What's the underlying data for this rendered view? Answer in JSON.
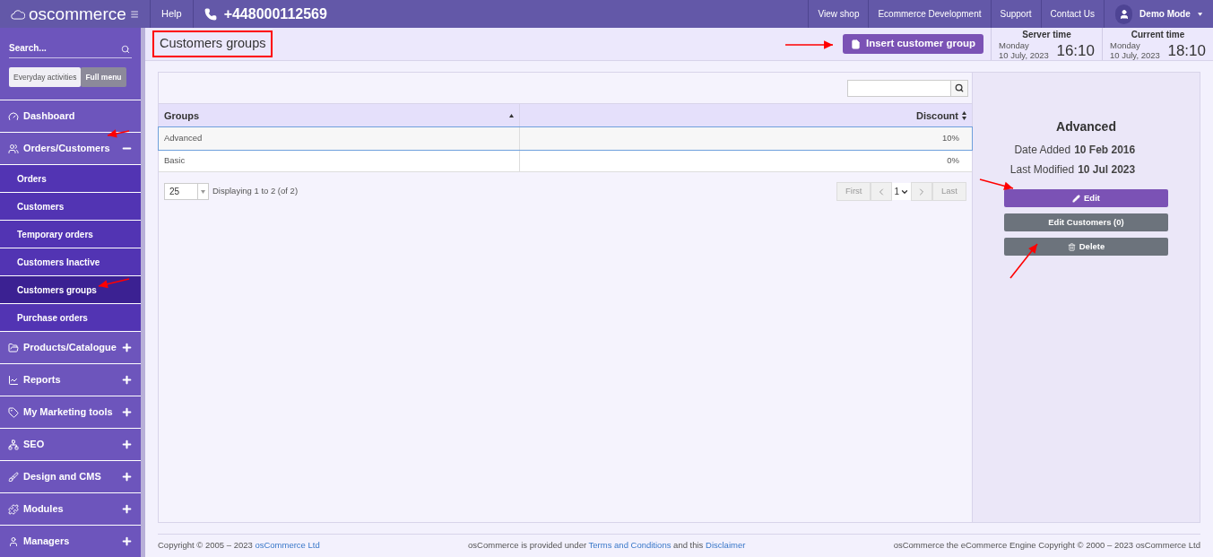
{
  "topbar": {
    "logo": "oscommerce",
    "help": "Help",
    "phone": "+448000112569",
    "links": [
      "View shop",
      "Ecommerce Development",
      "Support",
      "Contact Us"
    ],
    "user": "Demo Mode"
  },
  "sidebar": {
    "search": {
      "placeholder": "Search..."
    },
    "modes": [
      {
        "label": "Everyday activities",
        "selected": false
      },
      {
        "label": "Full menu",
        "selected": true
      }
    ],
    "menu": [
      {
        "label": "Dashboard",
        "kind": "link"
      },
      {
        "label": "Orders/Customers",
        "kind": "group",
        "expanded": true,
        "children": [
          {
            "label": "Orders",
            "selected": false
          },
          {
            "label": "Customers",
            "selected": false
          },
          {
            "label": "Temporary orders",
            "selected": false
          },
          {
            "label": "Customers Inactive",
            "selected": false
          },
          {
            "label": "Customers groups",
            "selected": true
          },
          {
            "label": "Purchase orders",
            "selected": false
          }
        ]
      },
      {
        "label": "Products/Catalogue",
        "kind": "group",
        "expanded": false
      },
      {
        "label": "Reports",
        "kind": "group",
        "expanded": false
      },
      {
        "label": "My Marketing tools",
        "kind": "group",
        "expanded": false
      },
      {
        "label": "SEO",
        "kind": "group",
        "expanded": false
      },
      {
        "label": "Design and CMS",
        "kind": "group",
        "expanded": false
      },
      {
        "label": "Modules",
        "kind": "group",
        "expanded": false
      },
      {
        "label": "Managers",
        "kind": "group",
        "expanded": false
      }
    ]
  },
  "header": {
    "title": "Customers groups",
    "insert_button": "Insert customer group",
    "clocks": [
      {
        "label": "Server time",
        "day": "Monday",
        "date": "10 July, 2023",
        "time": "16:10"
      },
      {
        "label": "Current time",
        "day": "Monday",
        "date": "10 July, 2023",
        "time": "18:10"
      }
    ]
  },
  "table": {
    "columns": [
      "Groups",
      "Discount"
    ],
    "rows": [
      {
        "cells": [
          "Advanced",
          "10%"
        ],
        "selected": true
      },
      {
        "cells": [
          "Basic",
          "0%"
        ],
        "selected": false
      }
    ],
    "per_page": "25",
    "displaying": "Displaying 1 to 2 (of 2)",
    "pager": {
      "first": "First",
      "page": "1",
      "last": "Last"
    }
  },
  "details": {
    "name": "Advanced",
    "fields": [
      {
        "label": "Date Added",
        "value": "10 Feb 2016"
      },
      {
        "label": "Last Modified",
        "value": "10 Jul 2023"
      }
    ],
    "buttons": [
      {
        "label": "Edit",
        "kind": "primary"
      },
      {
        "label": "Edit Customers (0)",
        "kind": "secondary"
      },
      {
        "label": "Delete",
        "kind": "secondary"
      }
    ]
  },
  "footer": [
    [
      {
        "kind": "text",
        "text": "Copyright © 2005 – 2023 "
      },
      {
        "kind": "link",
        "text": "osCommerce Ltd"
      }
    ],
    [
      {
        "kind": "text",
        "text": "osCommerce is provided under "
      },
      {
        "kind": "link",
        "text": "Terms and Conditions"
      },
      {
        "kind": "text",
        "text": " and this "
      },
      {
        "kind": "link",
        "text": "Disclaimer"
      }
    ],
    [
      {
        "kind": "text",
        "text": "osCommerce the eCommerce Engine Copyright © 2000 – 2023 osCommerce Ltd"
      }
    ]
  ]
}
